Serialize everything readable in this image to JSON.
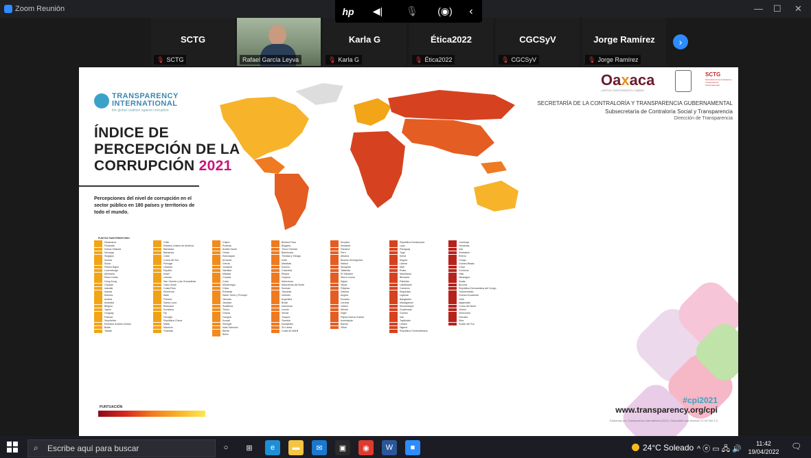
{
  "window": {
    "title": "Zoom Reunión",
    "minimize": "—",
    "maximize": "☐",
    "close": "✕"
  },
  "controls": {
    "items": [
      {
        "label": "ⓗ",
        "name": "hp-logo"
      },
      {
        "label": "◀ǀǀ",
        "name": "speaker"
      },
      {
        "label": "🎤",
        "name": "microphone"
      },
      {
        "label": "((•))",
        "name": "broadcast"
      },
      {
        "label": "❮",
        "name": "back"
      }
    ]
  },
  "participants": [
    {
      "name": "SCTG",
      "label": "SCTG",
      "video": false
    },
    {
      "name": "",
      "label": "Rafael García Leyva",
      "video": true
    },
    {
      "name": "Karla G",
      "label": "Karla G",
      "video": false
    },
    {
      "name": "Ética2022",
      "label": "Ética2022",
      "video": false
    },
    {
      "name": "CGCSyV",
      "label": "CGCSyV",
      "video": false
    },
    {
      "name": "Jorge Ramírez",
      "label": "Jorge Ramírez",
      "video": false
    }
  ],
  "next_page_icon": "›",
  "slide": {
    "ti_logo": {
      "line1": "TRANSPARENCY",
      "line2": "INTERNATIONAL",
      "tagline": "the global coalition against corruption"
    },
    "title": {
      "line1": "ÍNDICE DE",
      "line2": "PERCEPCIÓN DE LA",
      "line3": "CORRUPCIÓN",
      "year": "2021"
    },
    "description": "Percepciones del nivel de corrupción en el sector público en 180 países y territorios de todo el mundo.",
    "oaxaca": {
      "logo_a": "Oa",
      "logo_b": "x",
      "logo_c": "aca",
      "subtitle": "¡JUNTOS CONSTRUIMOS EL CAMBIO!",
      "sctg": "SCTG",
      "sctg_sub": "Secretaría de la Contraloría y Transparencia Gubernamental"
    },
    "header1": "SECRETARÍA DE LA CONTRALORÍA Y TRANSPARENCIA GUBERNAMENTAL",
    "header2": "Subsecretaría de Contraloría Social y Transparencia",
    "header3": "Dirección de Transparencia",
    "legend_title": "PUNTOS  PAÍS/TERRITORIO",
    "punt_label": "PUNTUACIÓN",
    "hashtag": "#cpi2021",
    "url": "www.transparency.org/cpi",
    "credit": "Elaborado por Transparency International (2021). Disponible bajo licencia CC BY-ND 4.0"
  },
  "columns": [
    {
      "color": "#f2a516",
      "items": [
        "Dinamarca",
        "Finlandia",
        "Nueva Zelanda",
        "Noruega",
        "Singapur",
        "Suecia",
        "Suiza",
        "Países Bajos",
        "Luxemburgo",
        "Alemania",
        "Reino Unido",
        "Hong Kong",
        "Canadá",
        "Islandia",
        "Irlanda",
        "Estonia",
        "Austria",
        "Australia",
        "Bélgica",
        "Japón",
        "Uruguay",
        "Francia",
        "Seychelles",
        "Emiratos Árabes Unidos",
        "Bután",
        "Taiwán"
      ]
    },
    {
      "color": "#f0a11a",
      "items": [
        "Chile",
        "Estados Unidos de América",
        "Barbados",
        "Bahamas",
        "Catar",
        "Corea del Sur",
        "Portugal",
        "Lituania",
        "España",
        "Israel",
        "Letonia",
        "San Vicente y las Granadinas",
        "Cabo Verde",
        "Costa Rica",
        "Eslovenia",
        "Italia",
        "Polonia",
        "Santa Lucía",
        "Botsuana",
        "Dominica",
        "Fiji",
        "Georgia",
        "República Checa",
        "Malta",
        "Mauricio",
        "Granada"
      ]
    },
    {
      "color": "#f08c1e",
      "items": [
        "Chipre",
        "Ruanda",
        "Arabia Saudí",
        "Omán",
        "Eslovaquia",
        "Armenia",
        "Grecia",
        "Jordania",
        "Namibia",
        "Malasia",
        "Croacia",
        "Cuba",
        "Montenegro",
        "China",
        "Rumania",
        "Santo Tomé y Príncipe",
        "Vanuatu",
        "Jamaica",
        "Sudáfrica",
        "Túnez",
        "Ghana",
        "Hungría",
        "Kuwait",
        "Senegal",
        "Islas Salomón",
        "Baréin",
        "Benín"
      ]
    },
    {
      "color": "#ee7a22",
      "items": [
        "Burkina Faso",
        "Bulgaria",
        "Timor Oriental",
        "Bielorrusia",
        "Trinidad y Tobago",
        "India",
        "Maldivas",
        "Kosovo",
        "Colombia",
        "Etiopía",
        "Guyana",
        "Marruecos",
        "Macedonia del Norte",
        "Surinam",
        "Tanzania",
        "Vietnam",
        "Argentina",
        "Brasil",
        "Indonesia",
        "Lesoto",
        "Serbia",
        "Turquía",
        "Gambia",
        "Kazajistán",
        "Sri Lanka",
        "Costa de Marfil"
      ]
    },
    {
      "color": "#e45d22",
      "items": [
        "Ecuador",
        "Moldavia",
        "Panamá",
        "Perú",
        "Albania",
        "Bosnia-Herzegovina",
        "Malaui",
        "Mongolia",
        "Tailandia",
        "El Salvador",
        "Sierra Leona",
        "Egipto",
        "Nepal",
        "Filipinas",
        "Zambia",
        "Angola",
        "Ecuador",
        "Ucrania",
        "Gabón",
        "México",
        "Níger",
        "Papúa Nueva Guinea",
        "Azerbaiyán",
        "Bolivia",
        "Yibuti"
      ]
    },
    {
      "color": "#d6421f",
      "items": [
        "República Dominicana",
        "Laos",
        "Paraguay",
        "Togo",
        "Kenia",
        "Angola",
        "Liberia",
        "Malí",
        "Rusia",
        "Mauritania",
        "Birmania",
        "Pakistán",
        "Uzbekistán",
        "Camerún",
        "Kirguistán",
        "Uganda",
        "Bangladés",
        "Madagascar",
        "Mozambique",
        "Guatemala",
        "Guinea",
        "Irán",
        "Tayikistán",
        "Líbano",
        "Nigeria",
        "República Centroafricana"
      ]
    },
    {
      "color": "#b5231d",
      "items": [
        "Camboya",
        "Honduras",
        "Irak",
        "Zimbabue",
        "Eritrea",
        "Congo",
        "Guinea Bissáu",
        "Chad",
        "Comoros",
        "Haití",
        "Nicaragua",
        "Sudán",
        "Burundi",
        "República Democrática del Congo",
        "Turkmenistán",
        "Guinea Ecuatorial",
        "Libia",
        "Afganistán",
        "Corea del Norte",
        "Yemen",
        "Venezuela",
        "Somalia",
        "Siria",
        "Sudán del Sur"
      ]
    }
  ],
  "taskbar": {
    "search_placeholder": "Escribe aquí para buscar",
    "apps": [
      {
        "name": "cortana",
        "glyph": "○",
        "bg": "transparent"
      },
      {
        "name": "task-view",
        "glyph": "⊞",
        "bg": "transparent"
      },
      {
        "name": "edge",
        "glyph": "e",
        "bg": "#1d8fd6"
      },
      {
        "name": "file-explorer",
        "glyph": "▬",
        "bg": "#f4c442"
      },
      {
        "name": "mail",
        "glyph": "✉",
        "bg": "#1979d0"
      },
      {
        "name": "store",
        "glyph": "▣",
        "bg": "#2a2a2a"
      },
      {
        "name": "chrome",
        "glyph": "◉",
        "bg": "#dd3b2f"
      },
      {
        "name": "word",
        "glyph": "W",
        "bg": "#2b579a"
      },
      {
        "name": "zoom",
        "glyph": "■",
        "bg": "#2d8cff"
      }
    ],
    "weather": "24°C Soleado",
    "tray": "^  ⓔ  ▭  🖧  🔊",
    "time": "11:42",
    "date": "19/04/2022",
    "notifications": "🗨"
  }
}
